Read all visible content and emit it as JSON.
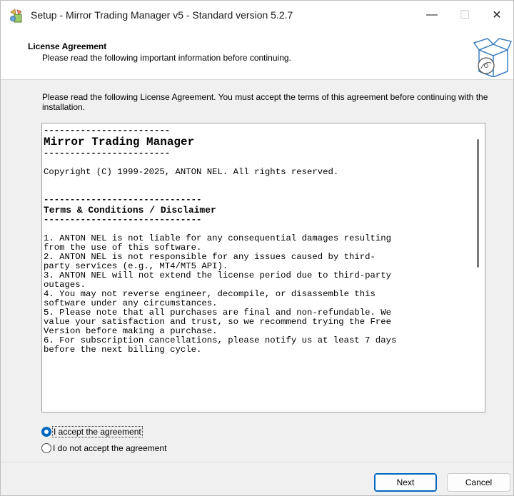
{
  "window": {
    "title": "Setup - Mirror Trading Manager v5 - Standard version 5.2.7",
    "minimize_glyph": "—",
    "maximize_glyph": "☐",
    "close_glyph": "✕"
  },
  "header": {
    "title": "License Agreement",
    "subtitle": "Please read the following important information before continuing."
  },
  "intro_text": "Please read the following License Agreement. You must accept the terms of this agreement before continuing with the installation.",
  "license": {
    "lines": [
      "------------------------",
      "Mirror Trading Manager",
      "------------------------",
      "",
      "Copyright (C) 1999-2025, ANTON NEL. All rights reserved.",
      "",
      "",
      "------------------------------",
      "Terms & Conditions / Disclaimer",
      "------------------------------",
      "",
      "1. ANTON NEL is not liable for any consequential damages resulting",
      "from the use of this software.",
      "2. ANTON NEL is not responsible for any issues caused by third-",
      "party services (e.g., MT4/MT5 API).",
      "3. ANTON NEL will not extend the license period due to third-party",
      "outages.",
      "4. You may not reverse engineer, decompile, or disassemble this",
      "software under any circumstances.",
      "5. Please note that all purchases are final and non-refundable. We",
      "value your satisfaction and trust, so we recommend trying the Free",
      "Version before making a purchase.",
      "6. For subscription cancellations, please notify us at least 7 days",
      "before the next billing cycle."
    ]
  },
  "options": {
    "accept_label": "I accept the agreement",
    "decline_label": "I do not accept the agreement",
    "selected": "accept"
  },
  "buttons": {
    "next_label": "Next",
    "cancel_label": "Cancel"
  },
  "icons": {
    "app": "setup-app-icon",
    "header": "software-box-icon"
  },
  "colors": {
    "accent": "#0067c0"
  }
}
